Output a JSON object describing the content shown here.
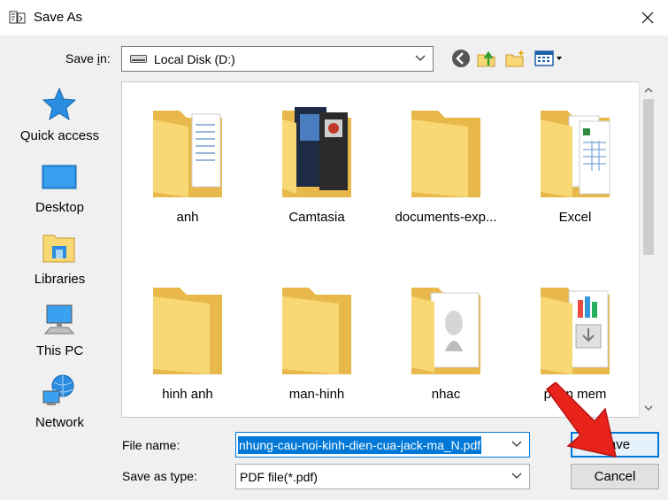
{
  "window": {
    "title": "Save As",
    "close_glyph": "✕"
  },
  "toolbar": {
    "save_in_label": "Save in:",
    "location": "Local Disk (D:)",
    "icons": [
      "back-icon",
      "up-folder-icon",
      "new-folder-icon",
      "view-menu-icon"
    ]
  },
  "places": [
    {
      "label": "Quick access",
      "icon": "star-icon"
    },
    {
      "label": "Desktop",
      "icon": "desktop-icon"
    },
    {
      "label": "Libraries",
      "icon": "libraries-icon"
    },
    {
      "label": "This PC",
      "icon": "computer-icon"
    },
    {
      "label": "Network",
      "icon": "network-icon"
    }
  ],
  "files": [
    {
      "label": "anh",
      "icon": "folder-with-documents-icon"
    },
    {
      "label": "Camtasia",
      "icon": "folder-with-images-icon"
    },
    {
      "label": "documents-exp...",
      "icon": "folder-icon"
    },
    {
      "label": "Excel",
      "icon": "folder-with-spreadsheets-icon"
    },
    {
      "label": "hinh anh",
      "icon": "folder-icon"
    },
    {
      "label": "man-hinh",
      "icon": "folder-icon"
    },
    {
      "label": "nhac",
      "icon": "folder-with-image-icon"
    },
    {
      "label": "phan mem",
      "icon": "folder-with-installers-icon"
    }
  ],
  "form": {
    "file_name_label": "File name:",
    "file_name_value": "nhung-cau-noi-kinh-dien-cua-jack-ma_N.pdf",
    "save_type_label": "Save as type:",
    "save_type_value": "PDF file(*.pdf)"
  },
  "buttons": {
    "save": "Save",
    "cancel": "Cancel"
  },
  "colors": {
    "accent": "#0078d7",
    "folder": "#f8d775",
    "folder_dark": "#e8b94a",
    "annotation": "#e8231c"
  }
}
